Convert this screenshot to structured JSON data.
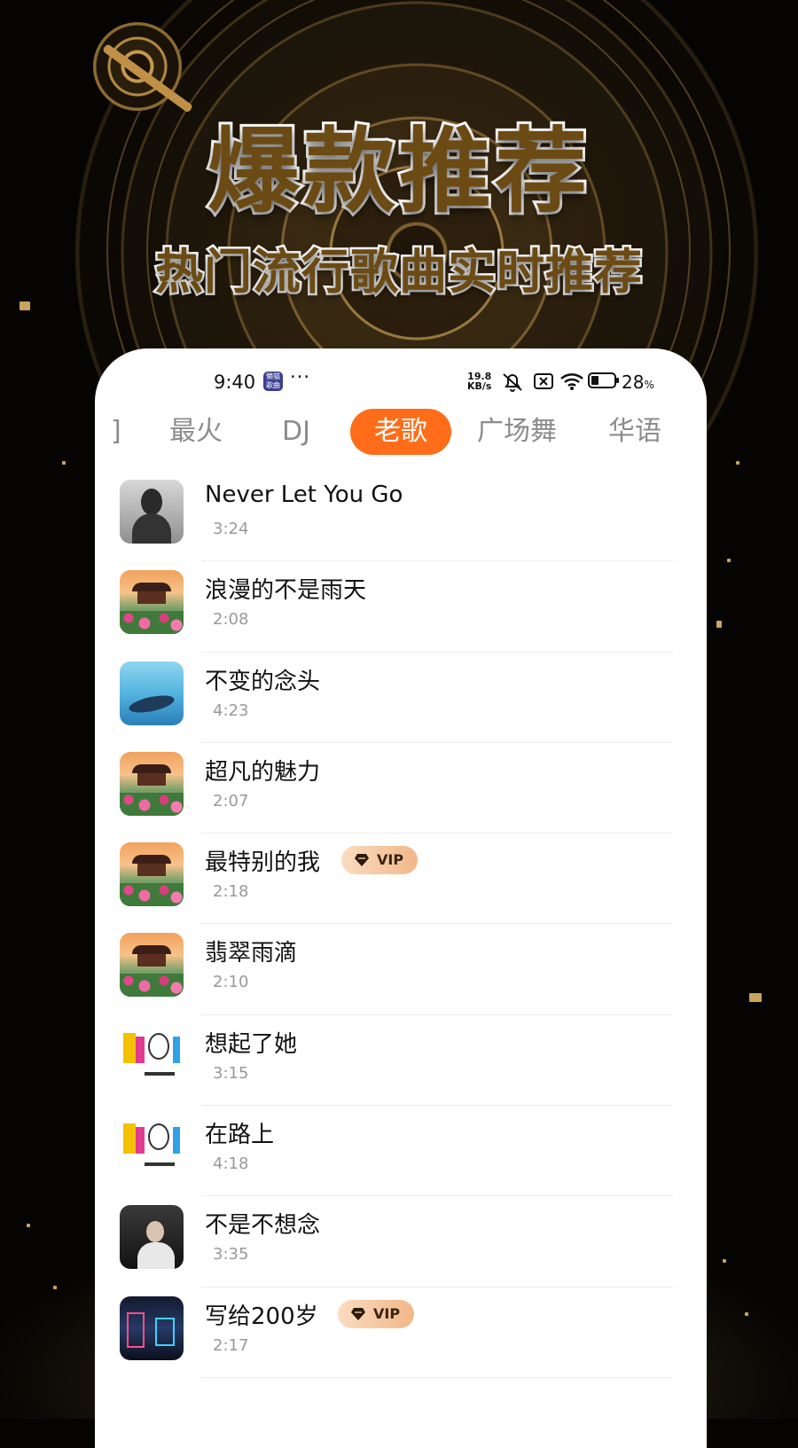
{
  "poster": {
    "title": "爆款推荐",
    "subtitle": "热门流行歌曲实时推荐"
  },
  "status_bar": {
    "time": "9:40",
    "app_icon_text": "懒猫歌曲",
    "more": "···",
    "net_speed_value": "19.8",
    "net_speed_unit": "KB/s",
    "battery_percent": "28",
    "battery_unit": "%",
    "icons": [
      "mute-icon",
      "sim-off-icon",
      "wifi-icon",
      "battery-icon"
    ]
  },
  "tabs": {
    "items": [
      {
        "label": "]",
        "active": false
      },
      {
        "label": "最火",
        "active": false
      },
      {
        "label": "DJ",
        "active": false
      },
      {
        "label": "老歌",
        "active": true
      },
      {
        "label": "广场舞",
        "active": false
      },
      {
        "label": "华语",
        "active": false
      }
    ],
    "active_color": "#ff6d1a"
  },
  "songs": [
    {
      "title": "Never Let You Go",
      "duration": "3:24",
      "vip": false,
      "cover": "portrait"
    },
    {
      "title": "浪漫的不是雨天",
      "duration": "2:08",
      "vip": false,
      "cover": "pavilion"
    },
    {
      "title": "不变的念头",
      "duration": "4:23",
      "vip": false,
      "cover": "whale"
    },
    {
      "title": "超凡的魅力",
      "duration": "2:07",
      "vip": false,
      "cover": "pavilion"
    },
    {
      "title": "最特别的我",
      "duration": "2:18",
      "vip": true,
      "cover": "pavilion"
    },
    {
      "title": "翡翠雨滴",
      "duration": "2:10",
      "vip": false,
      "cover": "pavilion"
    },
    {
      "title": "想起了她",
      "duration": "3:15",
      "vip": false,
      "cover": "graffiti"
    },
    {
      "title": "在路上",
      "duration": "4:18",
      "vip": false,
      "cover": "graffiti"
    },
    {
      "title": "不是不想念",
      "duration": "3:35",
      "vip": false,
      "cover": "man"
    },
    {
      "title": "写给200岁",
      "duration": "2:17",
      "vip": true,
      "cover": "neon"
    }
  ],
  "vip_label": "VIP"
}
